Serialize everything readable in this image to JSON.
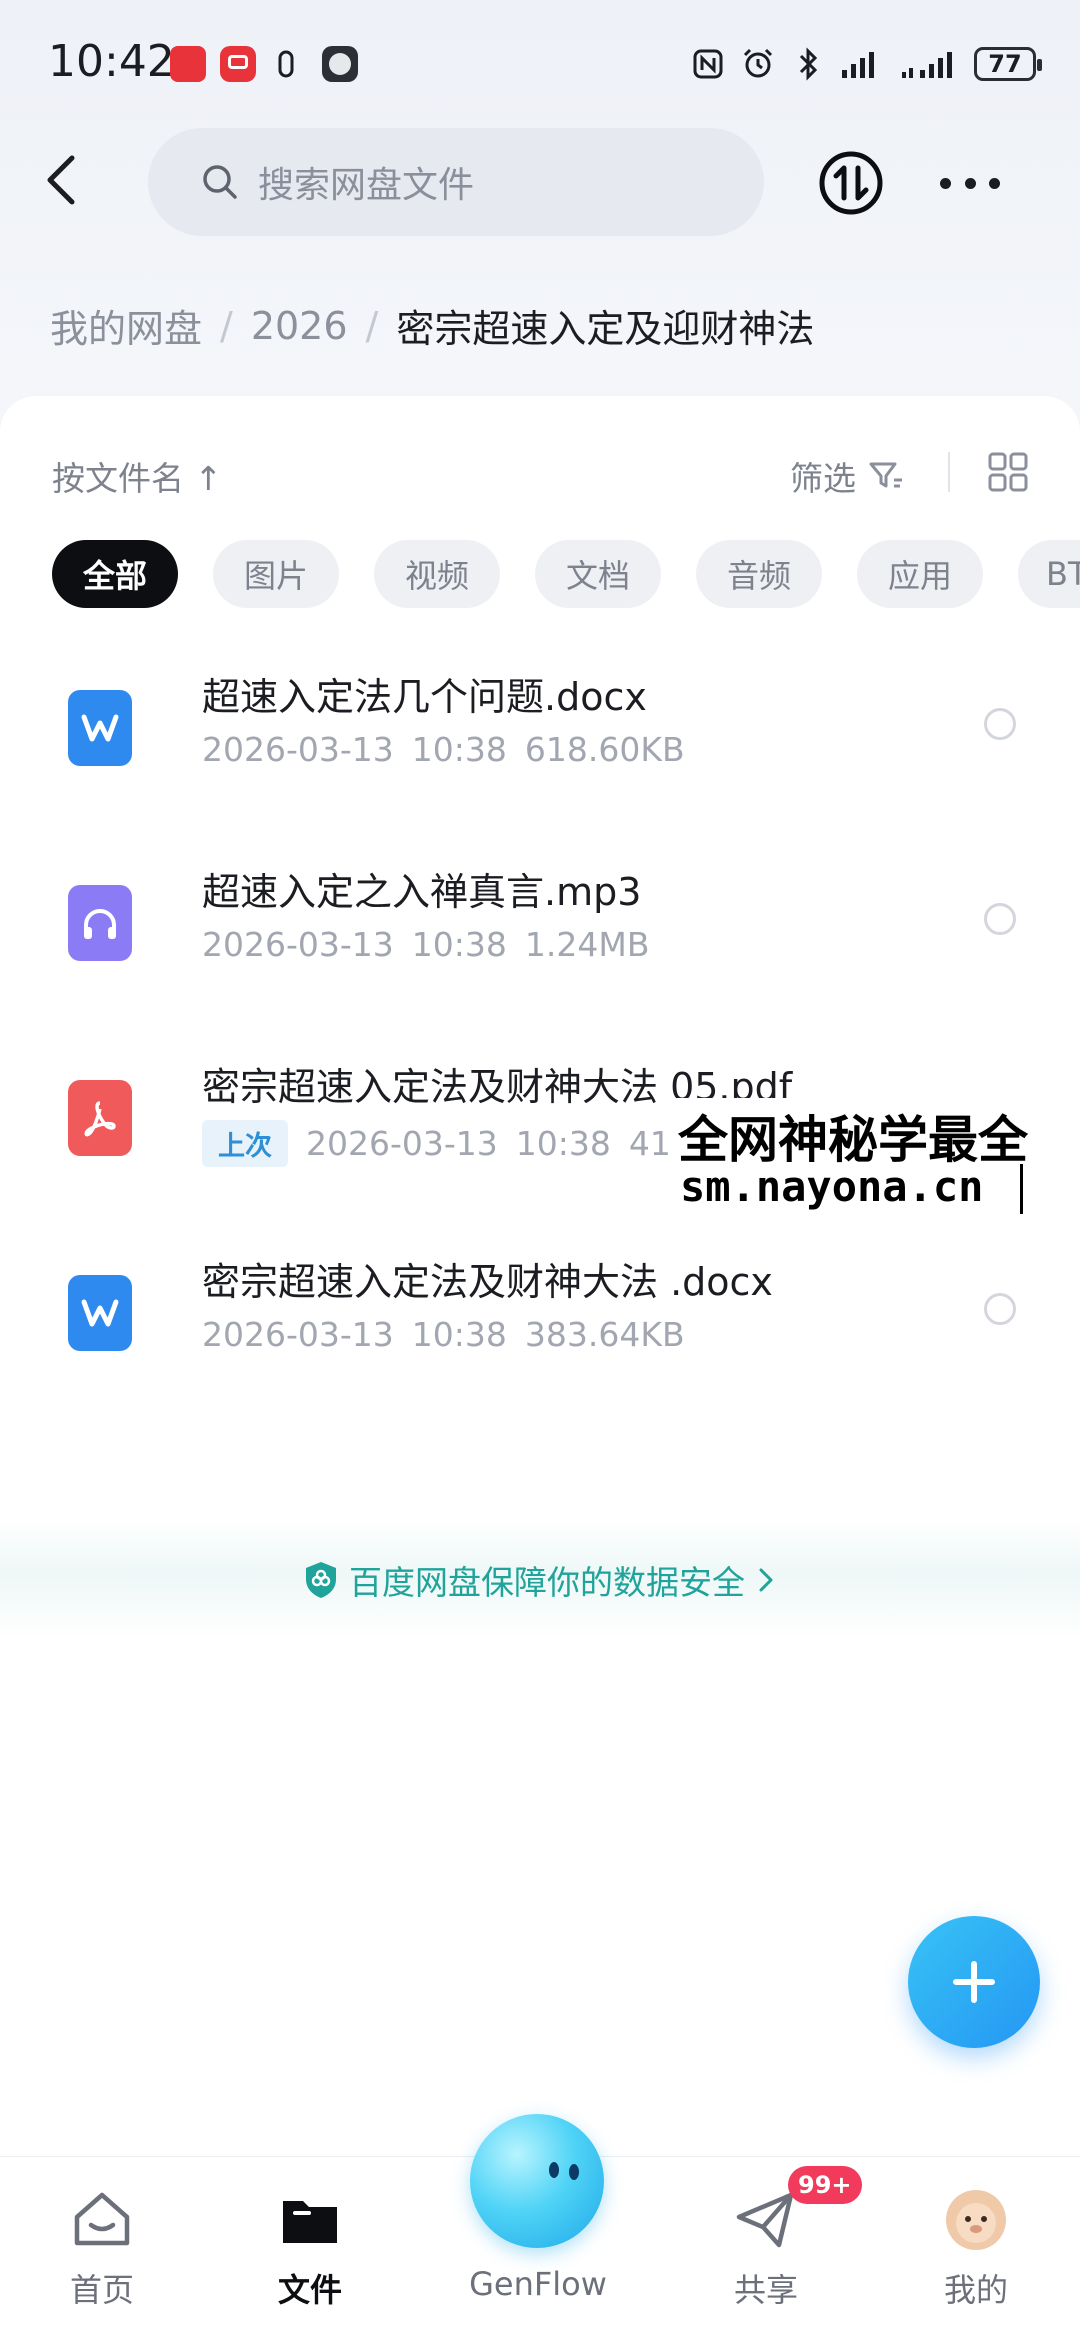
{
  "status_bar": {
    "time": "10:42",
    "battery": "77"
  },
  "header": {
    "search_placeholder": "搜索网盘文件"
  },
  "breadcrumb": {
    "root": "我的网盘",
    "sep1": "/",
    "folder": "2026",
    "sep2": "/",
    "current": "密宗超速入定及迎财神法"
  },
  "toolbar": {
    "sort_label": "按文件名 ↑",
    "filter_label": "筛选"
  },
  "tabs": [
    "全部",
    "图片",
    "视频",
    "文档",
    "音频",
    "应用",
    "BT"
  ],
  "files": [
    {
      "name": "超速入定法几个问题.docx",
      "date": "2026-03-13",
      "time": "10:38",
      "size": "618.60KB",
      "type": "word"
    },
    {
      "name": "超速入定之入禅真言.mp3",
      "date": "2026-03-13",
      "time": "10:38",
      "size": "1.24MB",
      "type": "audio"
    },
    {
      "name": "密宗超速入定法及财神大法 05.pdf",
      "badge": "上次",
      "date": "2026-03-13",
      "time": "10:38",
      "size": "41",
      "type": "pdf"
    },
    {
      "name": "密宗超速入定法及财神大法 .docx",
      "date": "2026-03-13",
      "time": "10:38",
      "size": "383.64KB",
      "type": "word"
    }
  ],
  "overlay": {
    "line1": "全网神秘学最全",
    "line2": "sm.nayona.cn"
  },
  "security_notice": "百度网盘保障你的数据安全",
  "nav": {
    "home": "首页",
    "files": "文件",
    "genflow": "GenFlow",
    "share": "共享",
    "me": "我的",
    "share_badge": "99+"
  },
  "colors": {
    "accent": "#2496f4",
    "word": "#2f8af0",
    "audio": "#8b7cf6",
    "pdf": "#f05a5a",
    "secure": "#20a39a"
  }
}
